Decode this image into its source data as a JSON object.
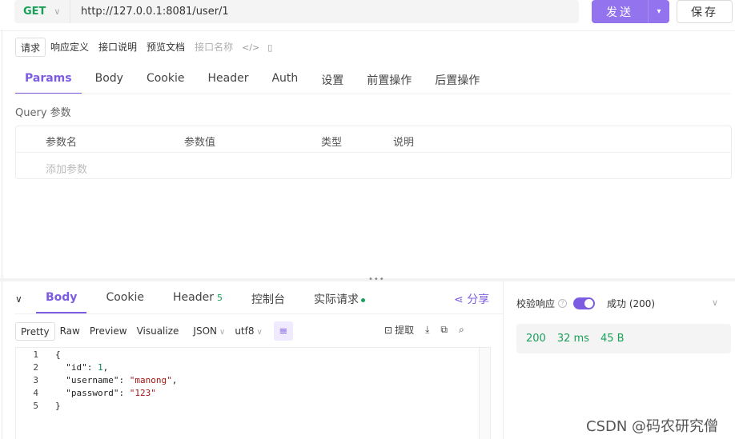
{
  "request": {
    "method": "GET",
    "url": "http://127.0.0.1:8081/user/1",
    "send_label": "发送",
    "save_label": "保存"
  },
  "sub_tabs": [
    "请求",
    "响应定义",
    "接口说明",
    "预览文档",
    "接口名称"
  ],
  "param_tabs": [
    "Params",
    "Body",
    "Cookie",
    "Header",
    "Auth",
    "设置",
    "前置操作",
    "后置操作"
  ],
  "query": {
    "label": "Query 参数",
    "columns": [
      "参数名",
      "参数值",
      "类型",
      "说明"
    ],
    "add_placeholder": "添加参数"
  },
  "response": {
    "tabs": {
      "body": "Body",
      "cookie": "Cookie",
      "header": "Header",
      "header_count": "5",
      "console": "控制台",
      "actual_request": "实际请求"
    },
    "share_label": "分享",
    "formats": [
      "Pretty",
      "Raw",
      "Preview",
      "Visualize"
    ],
    "format_select": "JSON",
    "encoding_select": "utf8",
    "extract_label": "提取",
    "code_lines": [
      {
        "n": "1",
        "text": "{"
      },
      {
        "n": "2",
        "text": "  \"id\": 1,"
      },
      {
        "n": "3",
        "text": "  \"username\": \"manong\","
      },
      {
        "n": "4",
        "text": "  \"password\": \"123\""
      },
      {
        "n": "5",
        "text": "}"
      }
    ]
  },
  "verify": {
    "label": "校验响应",
    "result": "成功 (200)",
    "status": "200",
    "time": "32 ms",
    "size": "45 B"
  },
  "watermark": "CSDN @码农研究僧",
  "colors": {
    "accent": "#7c5ce0",
    "success": "#18a058"
  }
}
